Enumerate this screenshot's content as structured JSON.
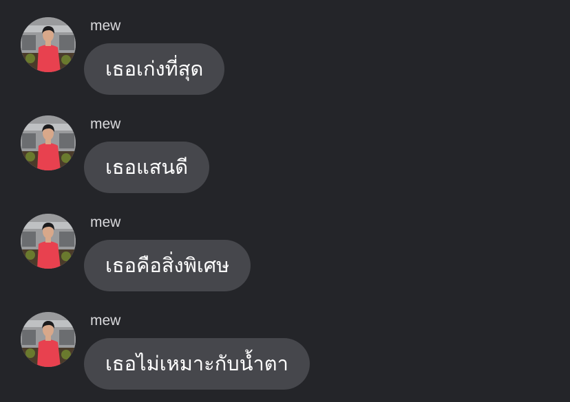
{
  "conversation": {
    "messages": [
      {
        "sender": "mew",
        "text": "เธอเก่งที่สุด",
        "avatar_icon": "profile-photo-icon"
      },
      {
        "sender": "mew",
        "text": "เธอแสนดี",
        "avatar_icon": "profile-photo-icon"
      },
      {
        "sender": "mew",
        "text": "เธอคือสิ่งพิเศษ",
        "avatar_icon": "profile-photo-icon"
      },
      {
        "sender": "mew",
        "text": "เธอไม่เหมาะกับน้ำตา",
        "avatar_icon": "profile-photo-icon"
      }
    ]
  },
  "colors": {
    "background": "#242529",
    "bubble": "#46474c",
    "bubble_text": "#ffffff",
    "sender_text": "#d9d9dc",
    "avatar_shirt": "#e8414f"
  }
}
